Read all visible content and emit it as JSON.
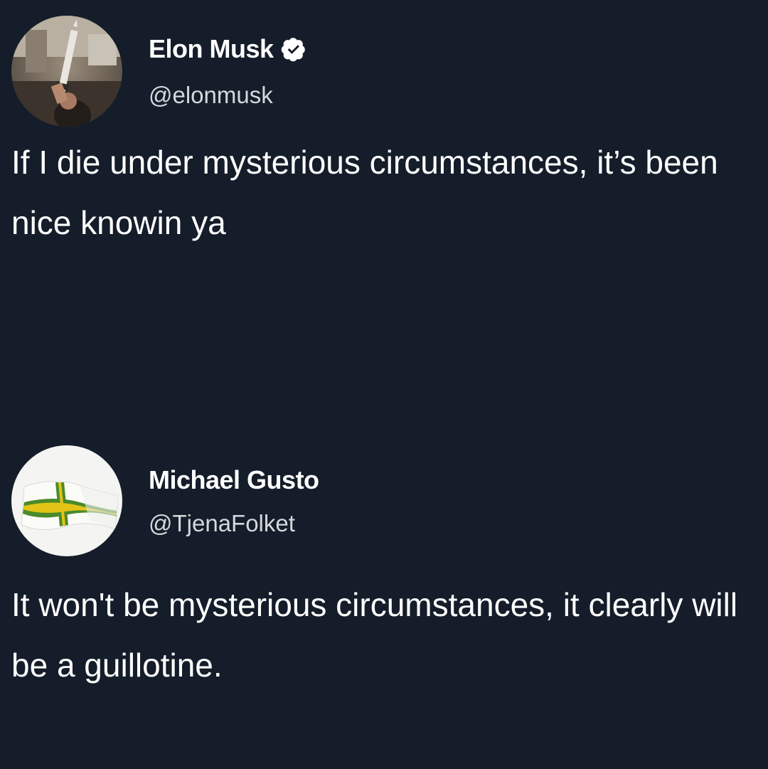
{
  "tweets": [
    {
      "author": {
        "display_name": "Elon Musk",
        "handle": "@elonmusk",
        "verified": true,
        "avatar_icon": "profile-photo"
      },
      "text": "If I die under mysterious circumstances, it’s been nice knowin ya"
    },
    {
      "author": {
        "display_name": "Michael Gusto",
        "handle": "@TjenaFolket",
        "verified": false,
        "avatar_icon": "flag-avatar"
      },
      "text": "It won't be mysterious circumstances, it clearly will be a guillotine."
    }
  ],
  "colors": {
    "background": "#141d29",
    "text_primary": "#ffffff",
    "text_secondary": "#d4d8dc",
    "flag_green": "#4a8a2a",
    "flag_yellow": "#e3c416"
  }
}
